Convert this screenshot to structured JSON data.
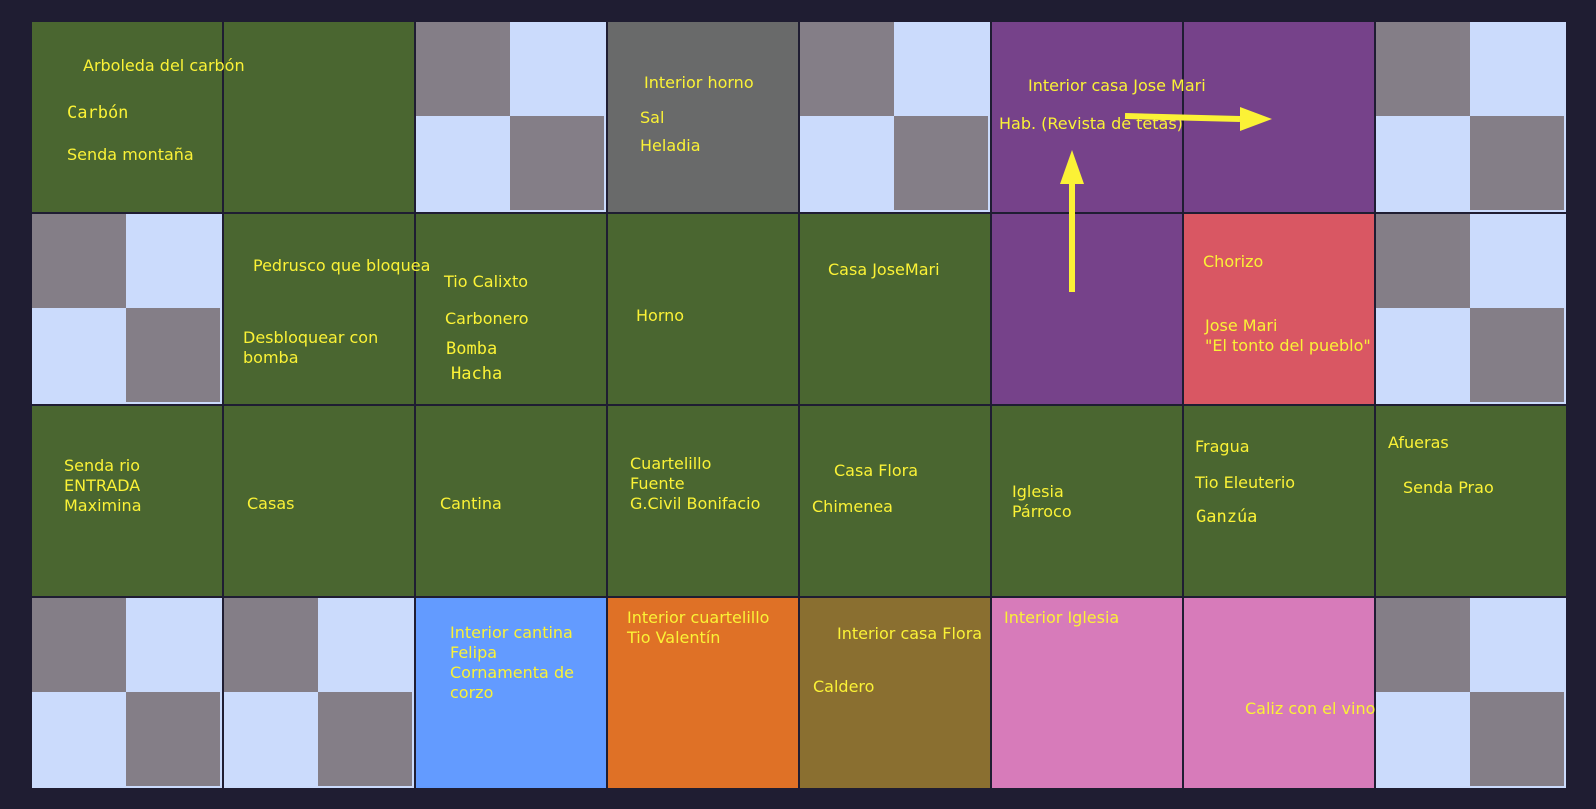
{
  "colors": {
    "background": "#1f1d32",
    "grass": "#4a6630",
    "purple": "#76428a",
    "red": "#d95763",
    "gray": "#696a6a",
    "blue": "#639bff",
    "orange": "#df7126",
    "olive": "#8a6f30",
    "pink": "#d77bba",
    "empty_light": "#cbdbfc",
    "empty_dark": "#847e87",
    "text": "#fbf236",
    "arrow": "#fbf236"
  },
  "map": {
    "rows": [
      [
        "grass",
        "grass",
        "empty",
        "gray",
        "empty",
        "purple",
        "purple",
        "empty"
      ],
      [
        "empty",
        "grass",
        "grass",
        "grass",
        "grass",
        "purple",
        "red",
        "empty"
      ],
      [
        "grass",
        "grass",
        "grass",
        "grass",
        "grass",
        "grass",
        "grass",
        "grass"
      ],
      [
        "empty",
        "empty",
        "blue",
        "orange",
        "olive",
        "pink",
        "pink",
        "empty"
      ]
    ],
    "labels": {
      "arboleda_title": "Arboleda del carbón",
      "arboleda_carbon": "Carbón",
      "arboleda_senda": "Senda montaña",
      "horno_interior": "Interior horno",
      "horno_sal": "Sal",
      "horno_heladia": "Heladia",
      "josemari_interior": "Interior casa Jose Mari",
      "josemari_hab": "Hab. (Revista de tetas)",
      "pedrusco": "Pedrusco que bloquea",
      "desbloquear": "Desbloquear con\nbomba",
      "tio_calixto": "Tio Calixto",
      "carbonero": "Carbonero",
      "bomba": "Bomba",
      "hacha": "Hacha",
      "horno": "Horno",
      "casa_josemari": "Casa JoseMari",
      "chorizo": "Chorizo",
      "jose_mari": "Jose Mari\n\"El tonto del pueblo\"",
      "senda_rio": "Senda rio\nENTRADA\nMaximina",
      "casas": "Casas",
      "cantina": "Cantina",
      "cuartelillo": "Cuartelillo\nFuente\nG.Civil Bonifacio",
      "casa_flora": "Casa Flora",
      "chimenea": "Chimenea",
      "iglesia": "Iglesia\nPárroco",
      "fragua": "Fragua",
      "tio_eleuterio": "Tio Eleuterio",
      "ganzua": "Ganzúa",
      "afueras": "Afueras",
      "senda_prao": "Senda Prao",
      "interior_cantina": "Interior cantina\nFelipa\nCornamenta de\ncorzo",
      "interior_cuartelillo": "Interior cuartelillo\nTio Valentín",
      "interior_casa_flora": "Interior casa Flora",
      "caldero": "Caldero",
      "interior_iglesia": "Interior Iglesia",
      "caliz": "Caliz con el vino"
    }
  }
}
